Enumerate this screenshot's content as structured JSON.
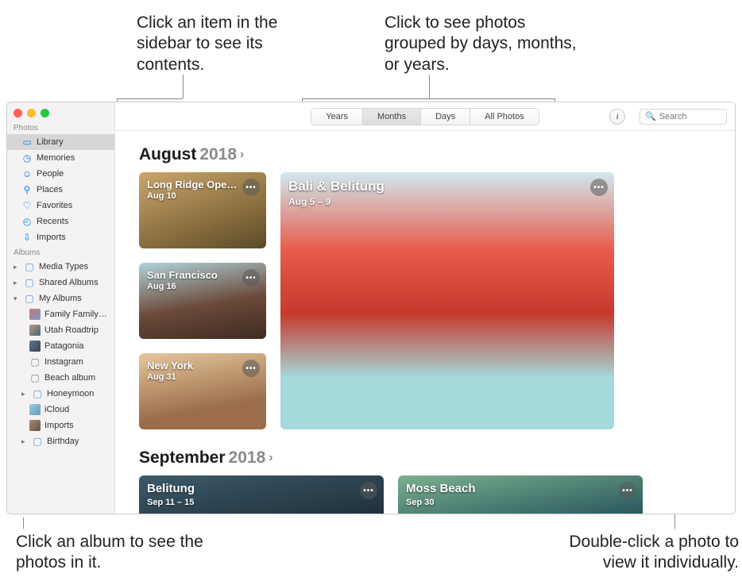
{
  "callouts": {
    "sidebar": "Click an item in the sidebar to see its contents.",
    "tabs": "Click to see photos grouped by days, months, or years.",
    "album": "Click an album to see the photos in it.",
    "photo": "Double-click a photo to view it individually."
  },
  "traffic": {
    "close": "#ff5f57",
    "min": "#febc2e",
    "max": "#28c840"
  },
  "sidebar": {
    "section_photos": "Photos",
    "library": "Library",
    "memories": "Memories",
    "people": "People",
    "places": "Places",
    "favorites": "Favorites",
    "recents": "Recents",
    "imports": "Imports",
    "section_albums": "Albums",
    "media_types": "Media Types",
    "shared_albums": "Shared Albums",
    "my_albums": "My Albums",
    "album_family": "Family Family…",
    "album_utah": "Utah Roadtrip",
    "album_patagonia": "Patagonia",
    "album_instagram": "Instagram",
    "album_beach": "Beach album",
    "album_honeymoon": "Honeymoon",
    "album_icloud": "iCloud",
    "album_imports": "Imports",
    "album_birthday": "Birthday"
  },
  "toolbar": {
    "tabs": {
      "years": "Years",
      "months": "Months",
      "days": "Days",
      "all": "All Photos"
    },
    "search_placeholder": "Search"
  },
  "months": {
    "aug_label": "August",
    "aug_year": "2018",
    "aug": {
      "long_ridge": {
        "title": "Long Ridge Ope…",
        "sub": "Aug 10"
      },
      "bali": {
        "title": "Bali & Belitung",
        "sub": "Aug 5 – 9"
      },
      "sf": {
        "title": "San Francisco",
        "sub": "Aug 16"
      },
      "ny": {
        "title": "New York",
        "sub": "Aug 31"
      }
    },
    "sep_label": "September",
    "sep_year": "2018",
    "sep": {
      "belitung": {
        "title": "Belitung",
        "sub": "Sep 11 – 15"
      },
      "moss": {
        "title": "Moss Beach",
        "sub": "Sep 30"
      }
    }
  }
}
